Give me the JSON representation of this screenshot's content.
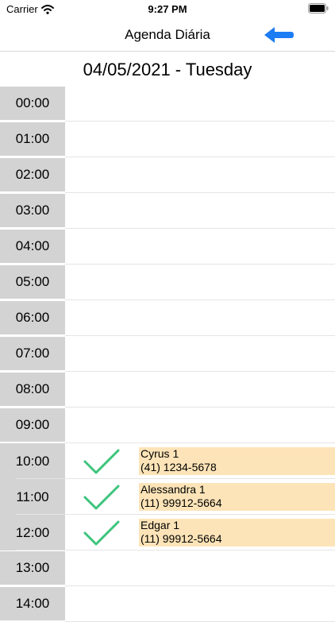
{
  "status_bar": {
    "carrier": "Carrier",
    "time": "9:27 PM"
  },
  "nav": {
    "title": "Agenda Diária",
    "back_icon": "left-arrow-icon",
    "accent": "#1c7cf4"
  },
  "date_header": "04/05/2021 - Tuesday",
  "colors": {
    "hour_bg": "#d3d3d3",
    "appointment_bg": "#fde4b8",
    "check": "#3cc47c"
  },
  "schedule": [
    {
      "hour": "00:00"
    },
    {
      "hour": "01:00"
    },
    {
      "hour": "02:00"
    },
    {
      "hour": "03:00"
    },
    {
      "hour": "04:00"
    },
    {
      "hour": "05:00"
    },
    {
      "hour": "06:00"
    },
    {
      "hour": "07:00"
    },
    {
      "hour": "08:00"
    },
    {
      "hour": "09:00"
    },
    {
      "hour": "10:00",
      "appointment": {
        "name": "Cyrus 1",
        "phone": "(41) 1234-5678",
        "confirmed": true
      }
    },
    {
      "hour": "11:00",
      "appointment": {
        "name": "Alessandra 1",
        "phone": "(11) 99912-5664",
        "confirmed": true
      }
    },
    {
      "hour": "12:00",
      "appointment": {
        "name": "Edgar 1",
        "phone": "(11) 99912-5664",
        "confirmed": true
      }
    },
    {
      "hour": "13:00"
    },
    {
      "hour": "14:00"
    }
  ]
}
